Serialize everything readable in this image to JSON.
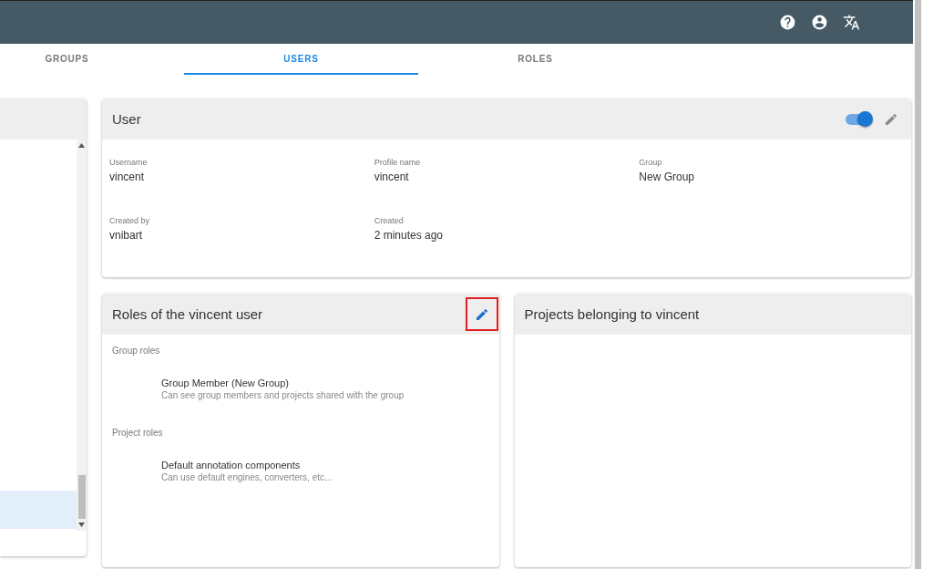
{
  "tabs": [
    {
      "label": "GROUPS",
      "selected": false
    },
    {
      "label": "USERS",
      "selected": true
    },
    {
      "label": "ROLES",
      "selected": false
    }
  ],
  "side_list": {
    "items": [
      {
        "selected": true
      }
    ]
  },
  "user_card": {
    "title": "User",
    "enabled": true,
    "fields": [
      {
        "label": "Username",
        "value": "vincent"
      },
      {
        "label": "Profile name",
        "value": "vincent"
      },
      {
        "label": "Group",
        "value": "New Group"
      },
      {
        "label": "Created by",
        "value": "vnibart"
      },
      {
        "label": "Created",
        "value": "2 minutes ago"
      }
    ]
  },
  "roles_card": {
    "title": "Roles of the vincent user",
    "edit_highlighted": true,
    "sections": [
      {
        "heading": "Group roles",
        "roles": [
          {
            "name": "Group Member (New Group)",
            "description": "Can see group members and projects shared with the group"
          }
        ]
      },
      {
        "heading": "Project roles",
        "roles": [
          {
            "name": "Default annotation components",
            "description": "Can use default engines, converters, etc..."
          }
        ]
      }
    ]
  },
  "projects_card": {
    "title": "Projects belonging to vincent"
  }
}
